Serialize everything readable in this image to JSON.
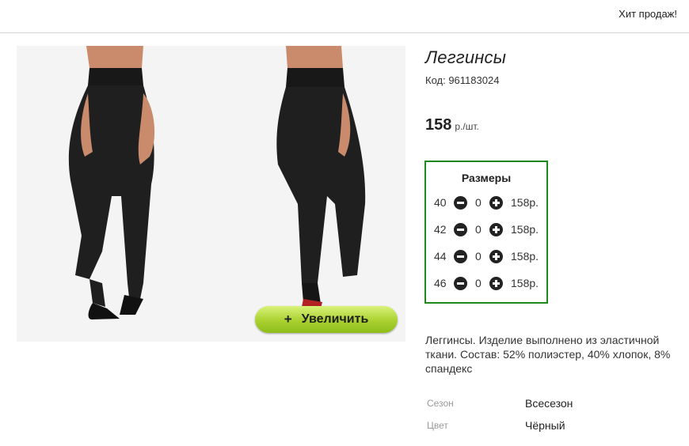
{
  "header": {
    "hit_label": "Хит продаж!"
  },
  "product": {
    "title": "Леггинсы",
    "code": "Код: 961183024",
    "price": {
      "amount": "158",
      "unit": "р./шт."
    },
    "zoom_button": "Увеличить",
    "zoom_plus": "+",
    "description": "Леггинсы. Изделие выполнено из эластичной ткани. Состав: 52% полиэстер, 40% хлопок, 8% спандекс"
  },
  "sizes": {
    "heading": "Размеры",
    "rows": [
      {
        "size": "40",
        "qty": "0",
        "price": "158р."
      },
      {
        "size": "42",
        "qty": "0",
        "price": "158р."
      },
      {
        "size": "44",
        "qty": "0",
        "price": "158р."
      },
      {
        "size": "46",
        "qty": "0",
        "price": "158р."
      }
    ]
  },
  "properties": [
    {
      "label": "Сезон",
      "value": "Всесезон"
    },
    {
      "label": "Цвет",
      "value": "Чёрный"
    }
  ],
  "colors": {
    "accent_green": "#1e8a1e",
    "button_green": "#a9d12f",
    "leggings": "#1f1f1f",
    "skin": "#c98b6b"
  }
}
